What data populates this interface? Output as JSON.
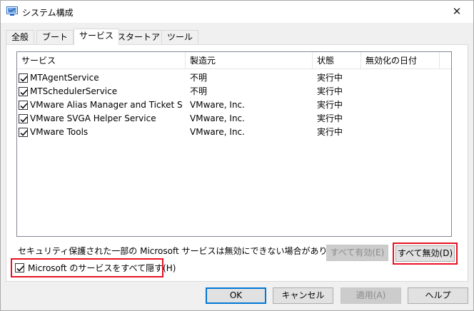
{
  "window": {
    "title": "システム構成",
    "close_glyph": "✕"
  },
  "tabs": [
    {
      "label": "全般"
    },
    {
      "label": "ブート"
    },
    {
      "label": "サービス",
      "active": true
    },
    {
      "label": "スタートアップ"
    },
    {
      "label": "ツール"
    }
  ],
  "services": {
    "columns": [
      "サービス",
      "製造元",
      "状態",
      "無効化の日付"
    ],
    "rows": [
      {
        "name": "MTAgentService",
        "manufacturer": "不明",
        "status": "実行中",
        "disabled_date": "",
        "checked": true
      },
      {
        "name": "MTSchedulerService",
        "manufacturer": "不明",
        "status": "実行中",
        "disabled_date": "",
        "checked": true
      },
      {
        "name": "VMware Alias Manager and Ticket Se...",
        "manufacturer": "VMware, Inc.",
        "status": "実行中",
        "disabled_date": "",
        "checked": true
      },
      {
        "name": "VMware SVGA Helper Service",
        "manufacturer": "VMware, Inc.",
        "status": "実行中",
        "disabled_date": "",
        "checked": true
      },
      {
        "name": "VMware Tools",
        "manufacturer": "VMware, Inc.",
        "status": "実行中",
        "disabled_date": "",
        "checked": true
      }
    ]
  },
  "note": "セキュリティ保護された一部の Microsoft サービスは無効にできない場合があります。",
  "buttons": {
    "enable_all": "すべて有効(E)",
    "disable_all": "すべて無効(D)",
    "ok": "OK",
    "cancel": "キャンセル",
    "apply": "適用(A)",
    "help": "ヘルプ"
  },
  "hide_microsoft": {
    "label": "Microsoft のサービスをすべて隠す(H)",
    "checked": true
  },
  "colors": {
    "highlight": "#e81123",
    "default_button_border": "#0078d7",
    "app_icon": "#2b6cc4"
  },
  "icons": {
    "app": "system-config-icon",
    "close": "close-icon",
    "check": "checkmark-icon"
  }
}
